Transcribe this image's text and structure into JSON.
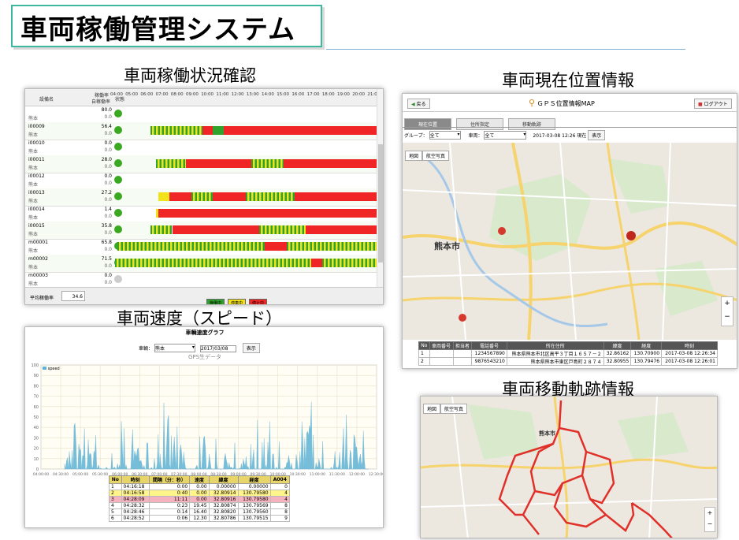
{
  "header": {
    "title": "車両稼働管理システム"
  },
  "sections": {
    "status": "車両稼働状況確認",
    "location": "車両現在位置情報",
    "speed": "車両速度（スピード）",
    "track": "車両移動軌跡情報"
  },
  "status_panel": {
    "col_device": "設備名",
    "col_rate": "稼働率",
    "col_rate2": "自稼働率",
    "col_status": "状態",
    "hours": [
      "04:00",
      "05:00",
      "06:00",
      "07:00",
      "08:00",
      "09:00",
      "10:00",
      "11:00",
      "12:00",
      "13:00",
      "14:00",
      "15:00",
      "16:00",
      "17:00",
      "18:00",
      "19:00",
      "20:00",
      "21:00"
    ],
    "rows": [
      {
        "id": "",
        "sub": "熊本 ",
        "v1": "80.0",
        "v2": "0.0",
        "color": "#3aa820"
      },
      {
        "id": "i00009",
        "sub": "熊本 ",
        "v1": "56.4",
        "v2": "0.0",
        "color": "#3aa820"
      },
      {
        "id": "i00010",
        "sub": "熊本 ",
        "v1": "0.0",
        "v2": "0.0",
        "color": "#3aa820"
      },
      {
        "id": "i00011",
        "sub": "熊本 ",
        "v1": "28.0",
        "v2": "0.0",
        "color": "#3aa820"
      },
      {
        "id": "i00012",
        "sub": "熊本 ",
        "v1": "0.0",
        "v2": "0.0",
        "color": "#3aa820"
      },
      {
        "id": "i00013",
        "sub": "熊本 ",
        "v1": "27.2",
        "v2": "0.0",
        "color": "#3aa820"
      },
      {
        "id": "i00014",
        "sub": "熊本 ",
        "v1": "1.4",
        "v2": "0.0",
        "color": "#3aa820"
      },
      {
        "id": "i00015",
        "sub": "熊本 ",
        "v1": "35.8",
        "v2": "0.0",
        "color": "#3aa820"
      },
      {
        "id": "m00001",
        "sub": "熊本 ",
        "v1": "65.8",
        "v2": "0.0",
        "color": "#3aa820"
      },
      {
        "id": "m00002",
        "sub": "熊本 ",
        "v1": "71.5",
        "v2": "0.0",
        "color": "#3aa820"
      },
      {
        "id": "m00003",
        "sub": "熊本 ",
        "v1": "0.0",
        "v2": "0.0",
        "color": "#cccccc"
      }
    ],
    "avg_label": "平均稼働率",
    "avg_value": "34.6",
    "legend": [
      {
        "label": "稼働中",
        "color": "#2fa32a"
      },
      {
        "label": "停車中",
        "color": "#f2e21a"
      },
      {
        "label": "停止中",
        "color": "#f02525"
      }
    ]
  },
  "location_panel": {
    "back": "戻る",
    "title": "ＧＰＳ位置情報MAP",
    "logout": "ログアウト",
    "tabs": [
      "現在位置",
      "住所指定",
      "移動軌跡"
    ],
    "group_label": "グループ：",
    "group_value": "全て",
    "vehicle_label": "車両：",
    "vehicle_value": "全て",
    "datetime": "2017-03-08 12:26 現在",
    "show": "表示",
    "map_types": [
      "地図",
      "航空写真"
    ],
    "city_label": "熊本市",
    "table_headers": [
      "No",
      "車両番号",
      "担当者",
      "電話番号",
      "所在住所",
      "緯度",
      "経度",
      "時刻"
    ],
    "table_rows": [
      [
        "1",
        "",
        "",
        "1234567890",
        "熊本県熊本市北区高平３丁目１６５７－２",
        "32.86162",
        "130.70900",
        "2017-03-08 12:26:34"
      ],
      [
        "2",
        "",
        "",
        "9876543210",
        "熊本県熊本市東区戸島町２８７４",
        "32.80955",
        "130.79476",
        "2017-03-08 12:26:01"
      ]
    ]
  },
  "speed_panel": {
    "title": "車輌速度グラフ",
    "vehicle_label": "車輌：",
    "vehicle_value": "熊本",
    "date": "2017/03/08",
    "show": "表示",
    "chart_title": "GPS生データ",
    "legend": "speed",
    "table_headers": [
      "No",
      "時刻",
      "間隔（分：秒）",
      "速度",
      "緯度",
      "経度",
      "A004"
    ],
    "table_rows": [
      [
        "1",
        "04:16:18",
        "0:00",
        "0.00",
        "0.00000",
        "0.00000",
        "0"
      ],
      [
        "2",
        "04:16:58",
        "0:40",
        "0.00",
        "32.80914",
        "130.79580",
        "4"
      ],
      [
        "3",
        "04:28:09",
        "11:11",
        "0.00",
        "32.80916",
        "130.79580",
        "4"
      ],
      [
        "4",
        "04:28:32",
        "0:23",
        "19.45",
        "32.80874",
        "130.79569",
        "8"
      ],
      [
        "5",
        "04:28:46",
        "0:14",
        "16.40",
        "32.80820",
        "130.79560",
        "8"
      ],
      [
        "6",
        "04:28:52",
        "0:06",
        "12.30",
        "32.80786",
        "130.79515",
        "9"
      ]
    ]
  },
  "chart_data": {
    "type": "area",
    "title": "GPS生データ",
    "series": [
      {
        "name": "speed"
      }
    ],
    "ylim": [
      0,
      100
    ],
    "y_ticks": [
      0,
      10,
      20,
      30,
      40,
      50,
      60,
      70,
      80,
      90,
      100
    ],
    "x_ticks": [
      "04:00:00",
      "04:30:00",
      "05:00:00",
      "05:30:00",
      "06:00:00",
      "06:30:00",
      "07:00:00",
      "07:30:00",
      "08:00:00",
      "08:30:00",
      "09:00:00",
      "09:30:00",
      "10:00:00",
      "10:30:00",
      "11:00:00",
      "11:30:00",
      "12:00:00",
      "12:30:00"
    ]
  },
  "colors": {
    "accent": "#3fb8a0",
    "run": "#2fa32a",
    "idle": "#f2e21a",
    "stop": "#f02525",
    "speed": "#5fb3d6"
  },
  "track_panel": {
    "map_types": [
      "地図",
      "航空写真"
    ],
    "city_label": "熊本市"
  }
}
